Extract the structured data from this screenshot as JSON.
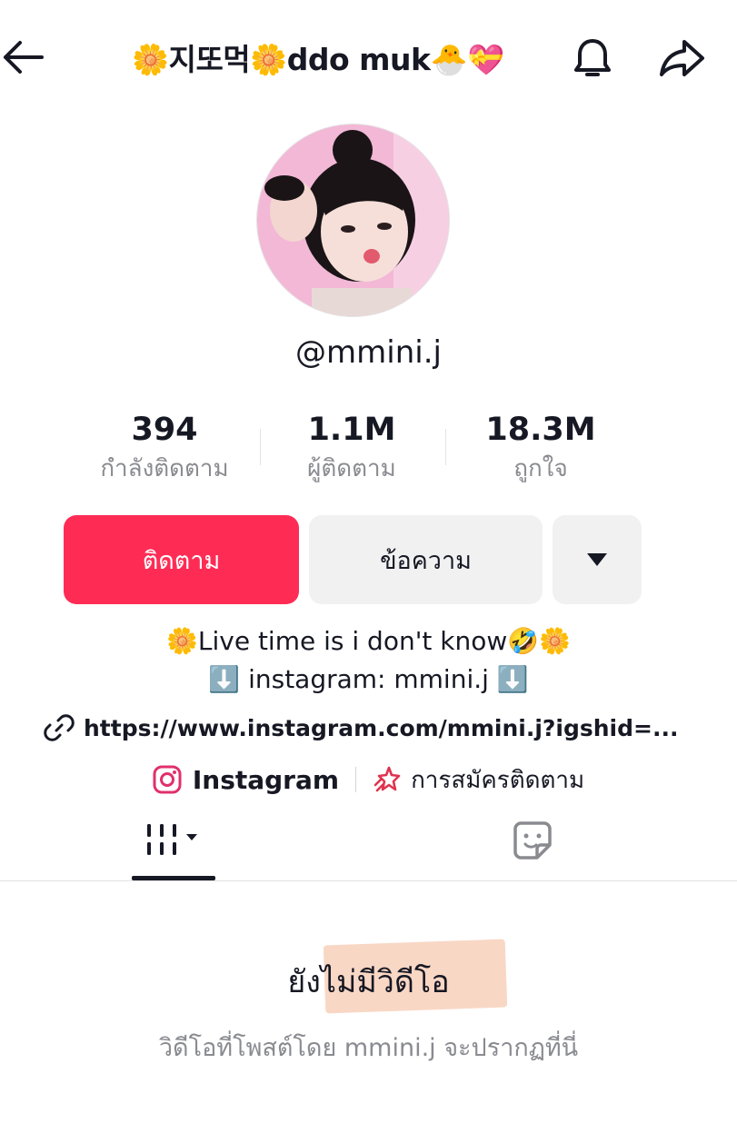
{
  "header": {
    "title": "🌼지또먹🌼ddo muk🐣💝",
    "back_icon": "back-arrow-icon",
    "bell_icon": "bell-icon",
    "share_icon": "share-icon"
  },
  "profile": {
    "username": "@mmini.j",
    "avatar_colors": {
      "background": "#f2b8d6",
      "hair": "#1a1416",
      "skin": "#f6dfd9"
    }
  },
  "stats": [
    {
      "value": "394",
      "label": "กำลังติดตาม"
    },
    {
      "value": "1.1M",
      "label": "ผู้ติดตาม"
    },
    {
      "value": "18.3M",
      "label": "ถูกใจ"
    }
  ],
  "actions": {
    "follow_label": "ติดตาม",
    "message_label": "ข้อความ",
    "more_icon": "caret-down-icon"
  },
  "bio": {
    "line1": "🌼Live time is i don't know🤣🌼",
    "line2": "⬇️ instagram: mmini.j ⬇️",
    "link": "https://www.instagram.com/mmini.j?igshid=..."
  },
  "social": {
    "instagram_label": "Instagram",
    "subscription_label": "การสมัครติดตาม"
  },
  "tabs": {
    "videos_icon": "videos-grid-icon",
    "stickers_icon": "sticker-icon"
  },
  "empty_state": {
    "title": "ยังไม่มีวิดีโอ",
    "subtitle": "วิดีโอที่โพสต์โดย mmini.j จะปรากฏที่นี่"
  },
  "colors": {
    "accent": "#fe2c55",
    "secondary_button": "#f1f1f2",
    "muted_text": "#8a8b91",
    "highlight": "#f6c2a6"
  }
}
